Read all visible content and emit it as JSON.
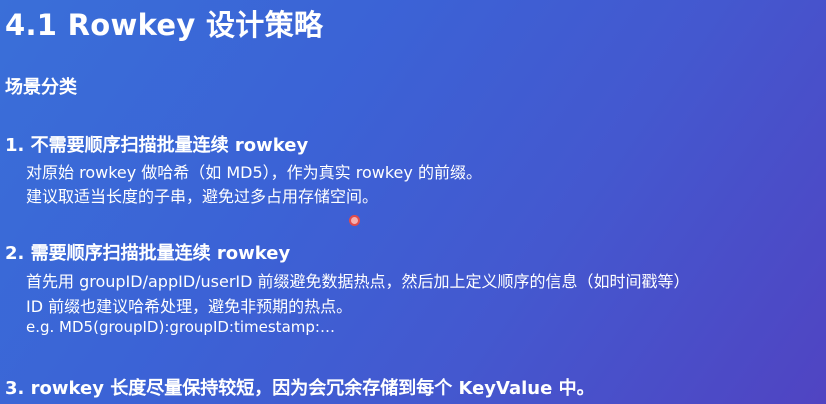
{
  "title": "4.1 Rowkey 设计策略",
  "subtitle": "场景分类",
  "items": [
    {
      "heading": "1. 不需要顺序扫描批量连续 rowkey",
      "lines": [
        "对原始 rowkey 做哈希（如 MD5），作为真实 rowkey 的前缀。",
        "建议取适当长度的子串，避免过多占用存储空间。"
      ]
    },
    {
      "heading": "2. 需要顺序扫描批量连续 rowkey",
      "lines": [
        "首先用 groupID/appID/userID 前缀避免数据热点，然后加上定义顺序的信息（如时间戳等）",
        "ID 前缀也建议哈希处理，避免非预期的热点。",
        "e.g. MD5(groupID):groupID:timestamp:…"
      ]
    },
    {
      "heading": "3. rowkey 长度尽量保持较短，因为会冗余存储到每个 KeyValue 中。",
      "lines": []
    }
  ]
}
